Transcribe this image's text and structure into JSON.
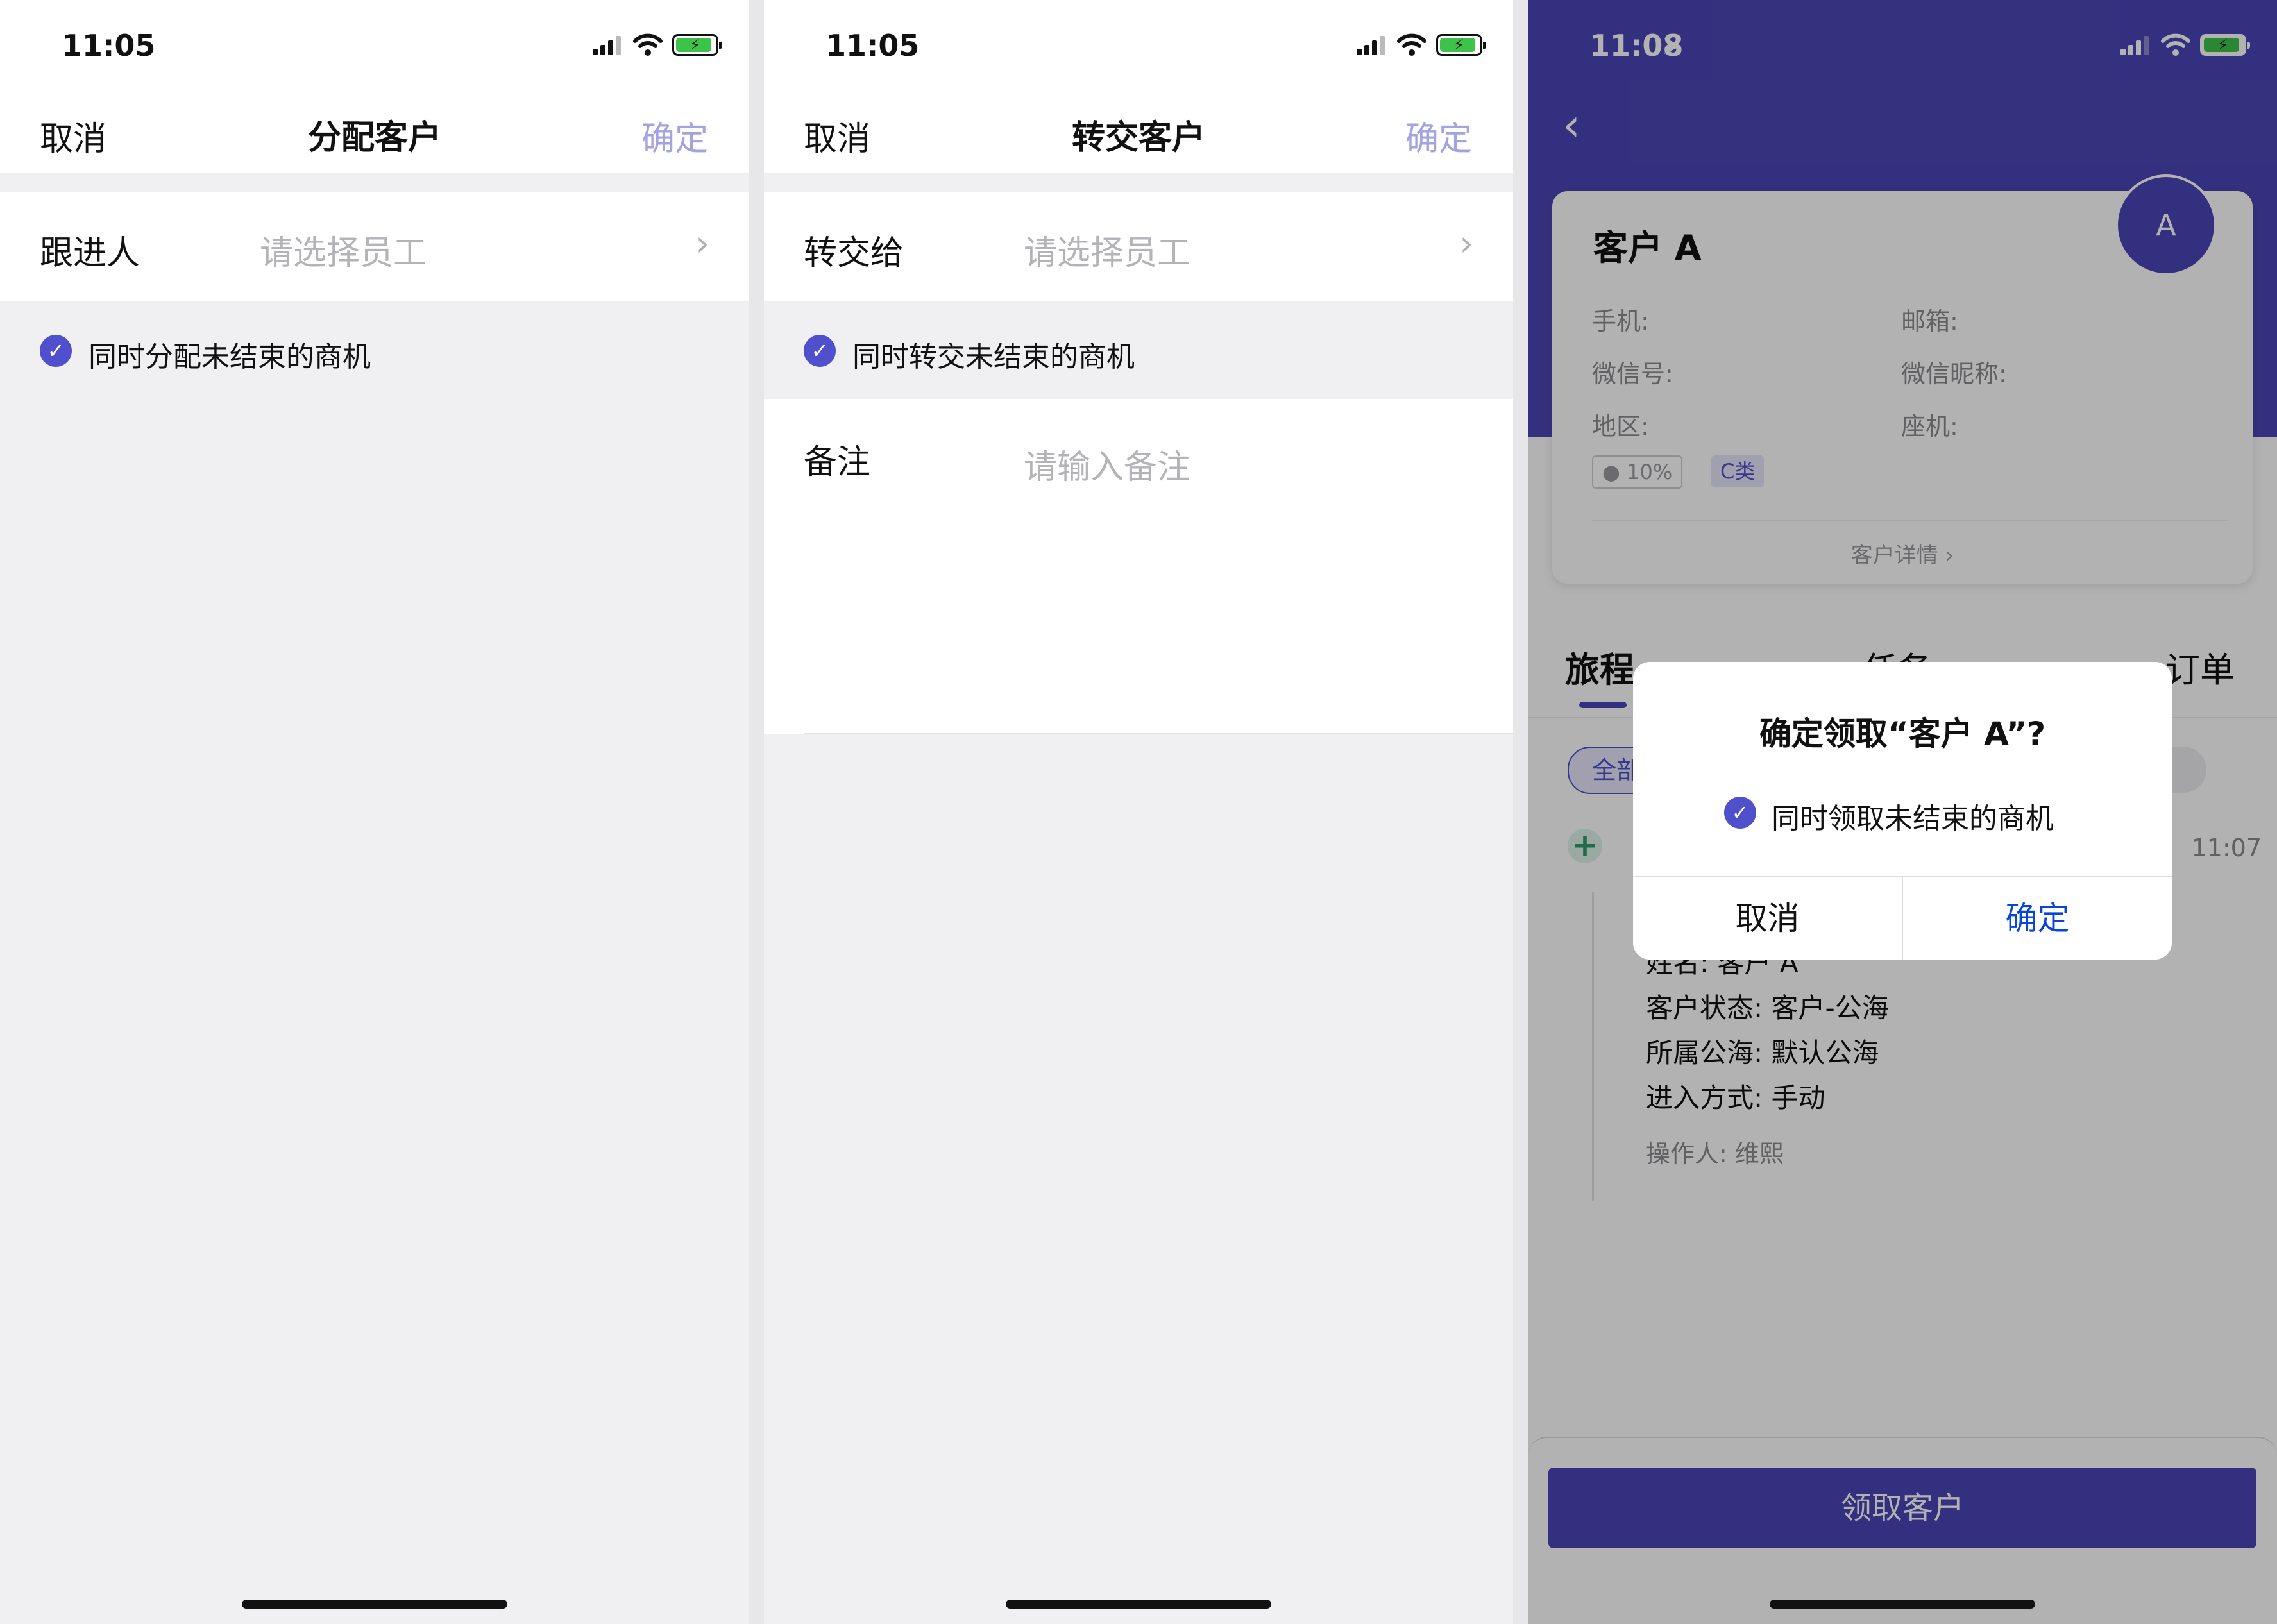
{
  "screen1": {
    "status_time": "11:05",
    "nav": {
      "cancel": "取消",
      "title": "分配客户",
      "ok": "确定"
    },
    "row": {
      "label": "跟进人",
      "placeholder": "请选择员工"
    },
    "checkbox_label": "同时分配未结束的商机"
  },
  "screen2": {
    "status_time": "11:05",
    "nav": {
      "cancel": "取消",
      "title": "转交客户",
      "ok": "确定"
    },
    "row": {
      "label": "转交给",
      "placeholder": "请选择员工"
    },
    "checkbox_label": "同时转交未结束的商机",
    "note": {
      "label": "备注",
      "placeholder": "请输入备注"
    }
  },
  "screen3": {
    "status_time": "11:08",
    "card": {
      "name": "客户 A",
      "avatar": "A",
      "fields": [
        "手机:",
        "邮箱:",
        "微信号:",
        "微信昵称:",
        "地区:",
        "座机:"
      ],
      "tags": [
        "10%",
        "C类"
      ],
      "detail_link": "客户详情"
    },
    "tabs": [
      "旅程",
      "任务",
      "订单"
    ],
    "filter_chip": "全部",
    "timeline": {
      "time": "11:07",
      "lines": [
        {
          "key": "姓名:",
          "value": "客户 A"
        },
        {
          "key": "客户状态:",
          "value": "客户-公海"
        },
        {
          "key": "所属公海:",
          "value": "默认公海"
        },
        {
          "key": "进入方式:",
          "value": "手动"
        }
      ],
      "operator": "操作人: 维熙"
    },
    "claim_button": "领取客户",
    "dialog": {
      "title": "确定领取“客户 A”?",
      "checkbox_label": "同时领取未结束的商机",
      "cancel": "取消",
      "ok": "确定"
    }
  },
  "colors": {
    "accent": "#5150cc",
    "header_purple": "#4a47b6",
    "ok_blue": "#0a45d9",
    "muted_ok": "#a3a3e0"
  }
}
